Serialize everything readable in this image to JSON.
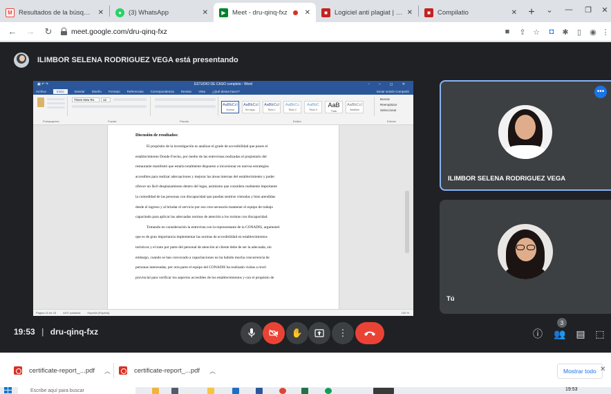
{
  "browser": {
    "tabs": [
      {
        "title": "Resultados de la búsqueda",
        "icon": "gmail-icon",
        "active": false
      },
      {
        "title": "(3) WhatsApp",
        "icon": "whatsapp-icon",
        "active": false
      },
      {
        "title": "Meet - dru-qinq-fxz",
        "icon": "meet-icon",
        "active": true
      },
      {
        "title": "Logiciel anti plagiat | Préventi",
        "icon": "compilatio-icon",
        "active": false
      },
      {
        "title": "Compilatio",
        "icon": "compilatio-icon",
        "active": false
      }
    ],
    "url": "meet.google.com/dru-qinq-fxz"
  },
  "meet": {
    "presenting_text": "ILIMBOR SELENA RODRIGUEZ VEGA está presentando",
    "participants": [
      {
        "name": "ILIMBOR SELENA RODRIGUEZ VEGA"
      },
      {
        "name": "Tú"
      }
    ],
    "time": "19:53",
    "separator": "|",
    "meeting_code": "dru-qinq-fxz",
    "participant_count": "3",
    "more_label": "•••"
  },
  "document": {
    "title": "ESTUDIO DE CASO completo - Word",
    "tabs": [
      "Archivo",
      "Inicio",
      "Insertar",
      "Diseño",
      "Formato",
      "Referencias",
      "Correspondencia",
      "Revisar",
      "Vista",
      "¿Qué desea hacer?"
    ],
    "tabs_right": "Iniciar sesión  Compartir",
    "ribbon_groups": [
      "Portapapeles",
      "Fuente",
      "Párrafo",
      "Estilos",
      "Edición"
    ],
    "font_name": "Times New Ro",
    "font_size": "12",
    "styles": [
      {
        "sample": "AaBbCcI",
        "name": "Normal"
      },
      {
        "sample": "AaBbCcI",
        "name": "Sin espa..."
      },
      {
        "sample": "AaBbCcI",
        "name": "Título 1"
      },
      {
        "sample": "AaBbCc",
        "name": "Título 2"
      },
      {
        "sample": "AaBbC",
        "name": "Título 3"
      },
      {
        "sample": "AaB",
        "name": "Título"
      },
      {
        "sample": "AaBbCcI",
        "name": "Subtítulo"
      }
    ],
    "edit_items": [
      "Buscar",
      "Reemplazar",
      "Seleccionar"
    ],
    "heading": "Discusión de resultados:",
    "lines": [
      "El propósito de la investigación es analizar el grado de accesibilidad que posee el",
      "establecimiento Donde Frecho, por medio de las entrevistas realizadas el propietario del",
      "restaurante manifestó que estaría totalmente dispuesto a incursionar en nuevas estrategias",
      "accesibles para realizar adecuaciones y mejorar las áreas internas del establecimiento y poder",
      "ofrecer un fácil desplazamiento dentro del lugar, asimismo que considera realmente importante",
      "la comodidad de las personas con discapacidad que puedan sentirse cómodas y bien atendidas",
      "desde el ingreso y al brindar el servicio por eso cree necesario mantener el equipo de trabajo",
      "capacitado para aplicar las adecuadas normas de atención a los turistas con discapacidad.",
      "Tomando en consideración la entrevista con la representante de la CONADIS, argumentó",
      "que es de gran importancia implementar las normas de accesibilidad en establecimientos",
      "turísticos y el trato por parte del personal de atención al cliente debe de ser la adecuada, sin",
      "embargo, cuando se han convocado a capacitaciones no ha habido mucha concurrencia de",
      "personas interesadas, por otra parte el equipo del CONADIS ha realizado visitas a nivel",
      "provincial para verificar los aspectos accesibles de los establecimientos y con el propósito de"
    ],
    "status_left": "Página 10 de 15",
    "status_words": "4407 palabras",
    "status_lang": "Español (España)",
    "status_zoom": "100 %"
  },
  "downloads": {
    "items": [
      "certificate-report_...pdf",
      "certificate-report_...pdf"
    ],
    "show_all": "Mostrar todo"
  },
  "taskbar": {
    "search_placeholder": "Escribe aquí para buscar",
    "clock": "19:53"
  },
  "colors": {
    "meet_bg": "#202124",
    "tile_bg": "#3c4043",
    "danger": "#ea4335",
    "accent": "#1a73e8",
    "word_blue": "#2b579a"
  }
}
